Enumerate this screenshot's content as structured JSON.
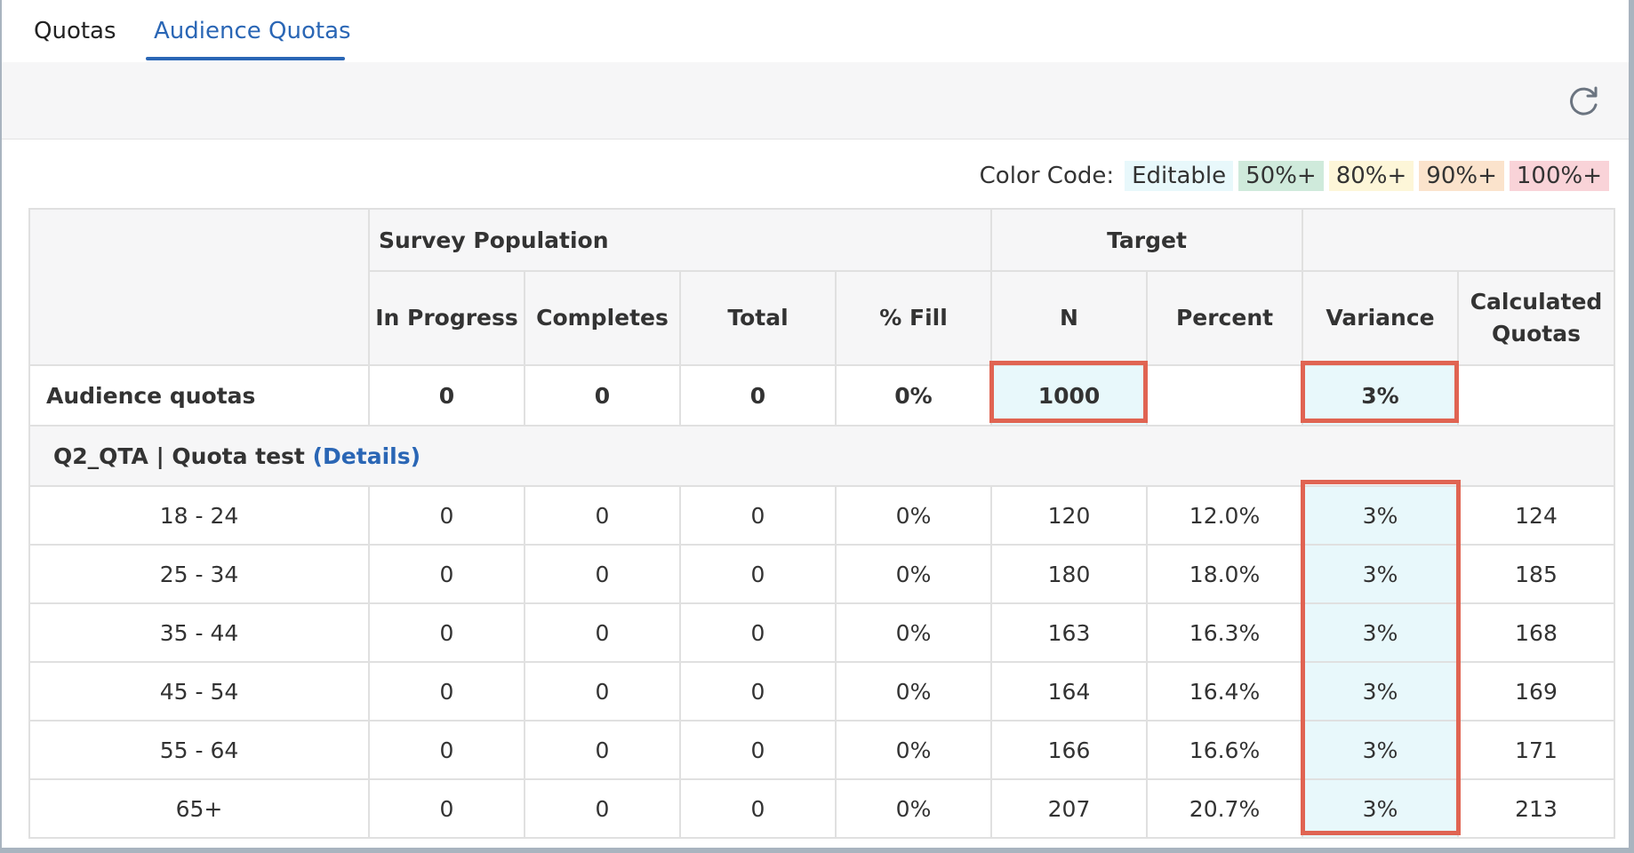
{
  "tabs": [
    {
      "label": "Quotas",
      "active": false
    },
    {
      "label": "Audience Quotas",
      "active": true
    }
  ],
  "toolbar": {
    "refresh_icon": "refresh-icon"
  },
  "color_code": {
    "label": "Color Code:",
    "chips": [
      {
        "label": "Editable",
        "color": "#e8f8fb"
      },
      {
        "label": "50%+",
        "color": "#cfeadb"
      },
      {
        "label": "80%+",
        "color": "#fdf6d8"
      },
      {
        "label": "90%+",
        "color": "#fbe3cc"
      },
      {
        "label": "100%+",
        "color": "#f9d3d8"
      }
    ]
  },
  "table": {
    "group_headers": {
      "survey_population": "Survey Population",
      "target": "Target"
    },
    "columns": {
      "in_progress": "In Progress",
      "completes": "Completes",
      "total": "Total",
      "fill": "% Fill",
      "n": "N",
      "percent": "Percent",
      "variance": "Variance",
      "calculated": "Calculated Quotas"
    },
    "summary": {
      "label": "Audience quotas",
      "in_progress": "0",
      "completes": "0",
      "total": "0",
      "fill": "0%",
      "n": "1000",
      "percent": "",
      "variance": "3%",
      "calculated": ""
    },
    "group": {
      "label": "Q2_QTA | Quota test",
      "details": "(Details)"
    },
    "rows": [
      {
        "label": "18 - 24",
        "in_progress": "0",
        "completes": "0",
        "total": "0",
        "fill": "0%",
        "n": "120",
        "percent": "12.0%",
        "variance": "3%",
        "calculated": "124"
      },
      {
        "label": "25 - 34",
        "in_progress": "0",
        "completes": "0",
        "total": "0",
        "fill": "0%",
        "n": "180",
        "percent": "18.0%",
        "variance": "3%",
        "calculated": "185"
      },
      {
        "label": "35 - 44",
        "in_progress": "0",
        "completes": "0",
        "total": "0",
        "fill": "0%",
        "n": "163",
        "percent": "16.3%",
        "variance": "3%",
        "calculated": "168"
      },
      {
        "label": "45 - 54",
        "in_progress": "0",
        "completes": "0",
        "total": "0",
        "fill": "0%",
        "n": "164",
        "percent": "16.4%",
        "variance": "3%",
        "calculated": "169"
      },
      {
        "label": "55 - 64",
        "in_progress": "0",
        "completes": "0",
        "total": "0",
        "fill": "0%",
        "n": "166",
        "percent": "16.6%",
        "variance": "3%",
        "calculated": "171"
      },
      {
        "label": "65+",
        "in_progress": "0",
        "completes": "0",
        "total": "0",
        "fill": "0%",
        "n": "207",
        "percent": "20.7%",
        "variance": "3%",
        "calculated": "213"
      }
    ]
  },
  "highlight_color": "#e06452"
}
